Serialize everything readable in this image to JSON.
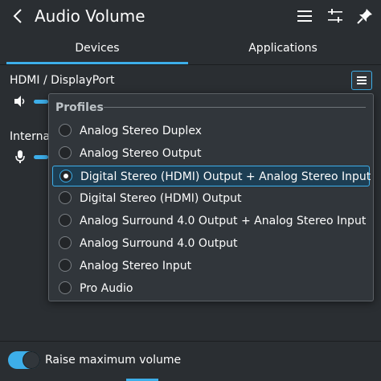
{
  "header": {
    "back_icon": "chevron-left-icon",
    "title": "Audio Volume",
    "menu_icon": "hamburger-icon",
    "configure_icon": "configure-icon",
    "pin_icon": "pin-icon"
  },
  "tabs": [
    {
      "label": "Devices",
      "active": true
    },
    {
      "label": "Applications",
      "active": false
    }
  ],
  "devices": [
    {
      "label": "HDMI / DisplayPort",
      "icon": "speaker-icon"
    },
    {
      "label": "Interna",
      "icon": "microphone-icon"
    }
  ],
  "profiles": {
    "title": "Profiles",
    "items": [
      {
        "label": "Analog Stereo Duplex",
        "selected": false
      },
      {
        "label": "Analog Stereo Output",
        "selected": false
      },
      {
        "label": "Digital Stereo (HDMI) Output + Analog Stereo Input",
        "selected": true
      },
      {
        "label": "Digital Stereo (HDMI) Output",
        "selected": false
      },
      {
        "label": "Analog Surround 4.0 Output + Analog Stereo Input",
        "selected": false
      },
      {
        "label": "Analog Surround 4.0 Output",
        "selected": false
      },
      {
        "label": "Analog Stereo Input",
        "selected": false
      },
      {
        "label": "Pro Audio",
        "selected": false
      }
    ]
  },
  "footer": {
    "toggle_label": "Raise maximum volume",
    "toggle_on": true
  },
  "colors": {
    "accent": "#3daee9",
    "background": "#2a2e32",
    "popup": "#31363b",
    "selected": "#1d3e53"
  }
}
